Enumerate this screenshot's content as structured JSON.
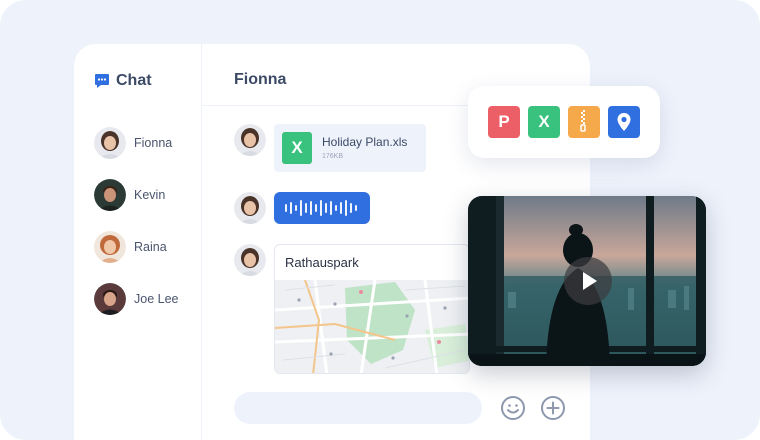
{
  "app": {
    "title": "Chat"
  },
  "contacts": [
    {
      "name": "Fionna"
    },
    {
      "name": "Kevin"
    },
    {
      "name": "Raina"
    },
    {
      "name": "Joe Lee"
    }
  ],
  "conversation": {
    "title": "Fionna",
    "file_message": {
      "icon_letter": "X",
      "file_name": "Holiday Plan.xls",
      "file_size": "176KB"
    },
    "location_message": {
      "place_name": "Rathauspark"
    }
  },
  "file_types": [
    {
      "label": "P",
      "color": "#ec5f67"
    },
    {
      "label": "X",
      "color": "#39c17e"
    },
    {
      "icon": "zip-icon",
      "color": "#f5a94a"
    },
    {
      "icon": "location-pin-icon",
      "color": "#2f6fe0"
    }
  ],
  "colors": {
    "accent": "#2f6fe0",
    "background": "#eef2fb",
    "text": "#3c4a66"
  }
}
